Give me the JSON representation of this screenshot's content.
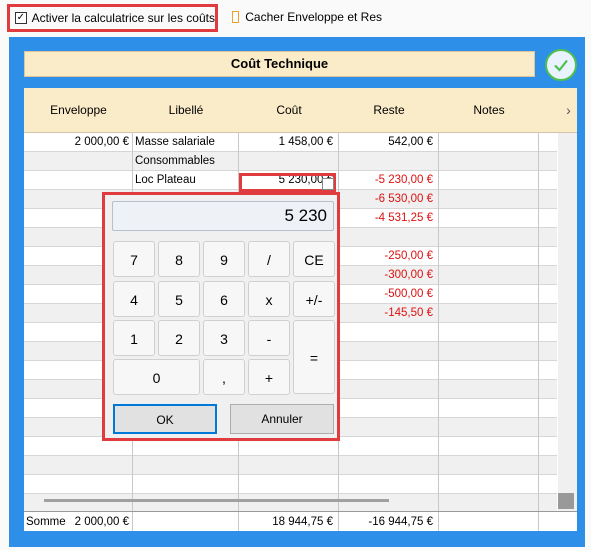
{
  "options": {
    "calc_label": "Activer la calculatrice sur les coûts",
    "calc_checked": "✓",
    "hide_label": "Cacher Enveloppe et Res"
  },
  "panel": {
    "title": "Coût Technique"
  },
  "table": {
    "headers": [
      "Enveloppe",
      "Libellé",
      "Coût",
      "Reste",
      "Notes"
    ],
    "rows": [
      {
        "env": "2 000,00 €",
        "lib": "Masse salariale",
        "cout": "1 458,00 €",
        "reste": "542,00 €",
        "red": false
      },
      {
        "env": "",
        "lib": "Consommables",
        "cout": "",
        "reste": "",
        "red": false
      },
      {
        "env": "",
        "lib": "Loc Plateau",
        "cout": "5 230,00 €",
        "reste": "-5 230,00 €",
        "red": true
      },
      {
        "env": "",
        "lib": "",
        "cout": "",
        "reste": "-6 530,00 €",
        "red": true
      },
      {
        "env": "",
        "lib": "",
        "cout": "",
        "reste": "-4 531,25 €",
        "red": true
      },
      {
        "env": "",
        "lib": "",
        "cout": "",
        "reste": "",
        "red": false
      },
      {
        "env": "",
        "lib": "",
        "cout": "",
        "reste": "-250,00 €",
        "red": true
      },
      {
        "env": "",
        "lib": "",
        "cout": "",
        "reste": "-300,00 €",
        "red": true
      },
      {
        "env": "",
        "lib": "",
        "cout": "",
        "reste": "-500,00 €",
        "red": true
      },
      {
        "env": "",
        "lib": "",
        "cout": "",
        "reste": "-145,50 €",
        "red": true
      }
    ],
    "sum": {
      "label": "Somme",
      "env": "2 000,00 €",
      "cout": "18 944,75 €",
      "reste": "-16 944,75 €"
    }
  },
  "calculator": {
    "display": "5 230",
    "keys": [
      "7",
      "8",
      "9",
      "/",
      "CE",
      "4",
      "5",
      "6",
      "x",
      "+/-",
      "1",
      "2",
      "3",
      "-",
      "=",
      "0",
      ",",
      "+"
    ],
    "ok_label": "OK",
    "cancel_label": "Annuler"
  }
}
